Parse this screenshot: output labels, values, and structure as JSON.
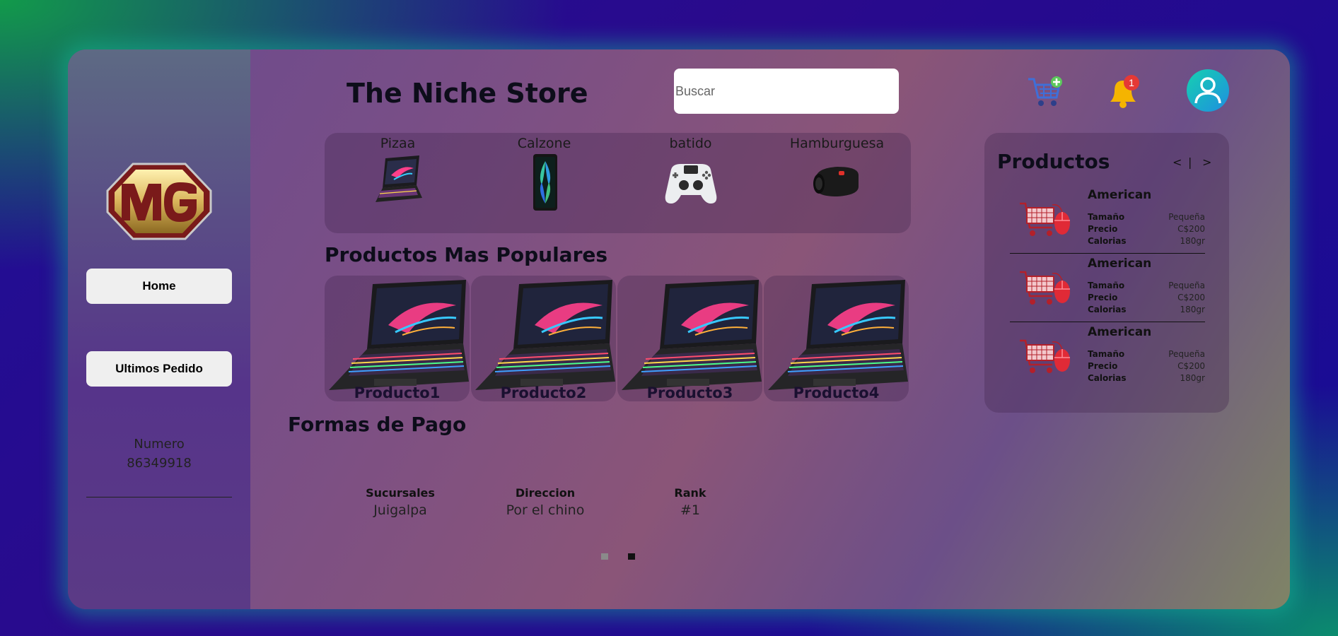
{
  "app": {
    "title": "The Niche Store"
  },
  "search": {
    "placeholder": "Buscar",
    "value": ""
  },
  "header": {
    "notification_count": "1"
  },
  "sidebar": {
    "home_label": "Home",
    "orders_label": "Ultimos Pedido",
    "numero_label": "Numero",
    "numero_value": "86349918"
  },
  "categories": [
    {
      "label": "Pizaa"
    },
    {
      "label": "Calzone"
    },
    {
      "label": "batido"
    },
    {
      "label": "Hamburguesa"
    }
  ],
  "popular": {
    "title": "Productos Mas Populares",
    "items": [
      {
        "label": "Producto1"
      },
      {
        "label": "Producto2"
      },
      {
        "label": "Producto3"
      },
      {
        "label": "Producto4"
      }
    ]
  },
  "payment": {
    "title": "Formas de Pago",
    "columns": [
      {
        "header": "Sucursales",
        "value": "Juigalpa"
      },
      {
        "header": "Direccion",
        "value": "Por el chino"
      },
      {
        "header": "Rank",
        "value": "#1"
      }
    ]
  },
  "products_panel": {
    "title": "Productos",
    "prev_label": "<",
    "separator": "|",
    "next_label": ">",
    "items": [
      {
        "name": "American",
        "size_label": "Tamaño",
        "size": "Pequeña",
        "price_label": "Precio",
        "price": "C$200",
        "cal_label": "Calorias",
        "cal": "180gr"
      },
      {
        "name": "American",
        "size_label": "Tamaño",
        "size": "Pequeña",
        "price_label": "Precio",
        "price": "C$200",
        "cal_label": "Calorias",
        "cal": "180gr"
      },
      {
        "name": "American",
        "size_label": "Tamaño",
        "size": "Pequeña",
        "price_label": "Precio",
        "price": "C$200",
        "cal_label": "Calorias",
        "cal": "180gr"
      }
    ]
  },
  "colors": {
    "accent_badge": "#e53935",
    "avatar": "#1fb8d8",
    "bell": "#f5b400"
  }
}
